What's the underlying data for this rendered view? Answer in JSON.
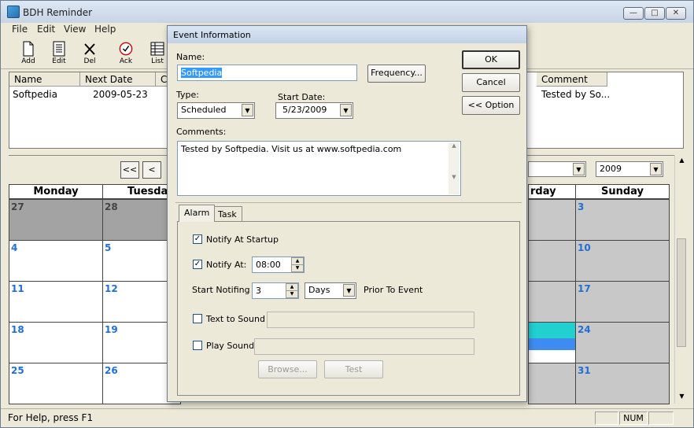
{
  "window": {
    "title": "BDH Reminder"
  },
  "menu": [
    "File",
    "Edit",
    "View",
    "Help"
  ],
  "toolbar": [
    {
      "label": "Add",
      "icon": "add-icon"
    },
    {
      "label": "Edit",
      "icon": "edit-icon"
    },
    {
      "label": "Del",
      "icon": "delete-icon"
    },
    {
      "label": "Ack",
      "icon": "acknowledge-icon"
    },
    {
      "label": "List",
      "icon": "list-icon"
    }
  ],
  "list": {
    "columns": [
      "Name",
      "Next Date",
      "Cu",
      "Comment"
    ],
    "row": {
      "name": "Softpedia",
      "next_date": "2009-05-23",
      "comment": "Tested by So..."
    }
  },
  "calendar": {
    "nav_prev_fast": "<<",
    "nav_prev": "<",
    "year": "2009",
    "headers": [
      "Monday",
      "Tuesday",
      "rday",
      "Sunday"
    ],
    "left_col1": [
      "27",
      "4",
      "11",
      "18",
      "25"
    ],
    "left_col2": [
      "28",
      "5",
      "12",
      "19",
      "26"
    ],
    "right_col": [
      "3",
      "10",
      "17",
      "24",
      "31"
    ]
  },
  "status": {
    "help": "For Help, press F1",
    "num": "NUM"
  },
  "dialog": {
    "title": "Event Information",
    "name_label": "Name:",
    "name_value": "Softpedia",
    "frequency_button": "Frequency...",
    "ok_button": "OK",
    "cancel_button": "Cancel",
    "option_button": "<< Option",
    "type_label": "Type:",
    "type_value": "Scheduled",
    "start_date_label": "Start Date:",
    "start_date_value": "5/23/2009",
    "comments_label": "Comments:",
    "comments_value": "Tested by Softpedia. Visit us at www.softpedia.com",
    "tabs": [
      "Alarm",
      "Task"
    ],
    "notify_startup": "Notify At Startup",
    "notify_at": "Notify At:",
    "notify_time": "08:00",
    "start_notifying": "Start Notifing",
    "start_notifying_value": "3",
    "unit_value": "Days",
    "prior": "Prior To Event",
    "text_to_sound": "Text to Sound",
    "play_sound": "Play Sound",
    "browse_button": "Browse...",
    "test_button": "Test"
  },
  "colors": {
    "day_number": "#1f6fd4",
    "selected_text_bg": "#3399ff",
    "cyan_event": "#22d0d0",
    "blue_event": "#3f8cf0"
  }
}
